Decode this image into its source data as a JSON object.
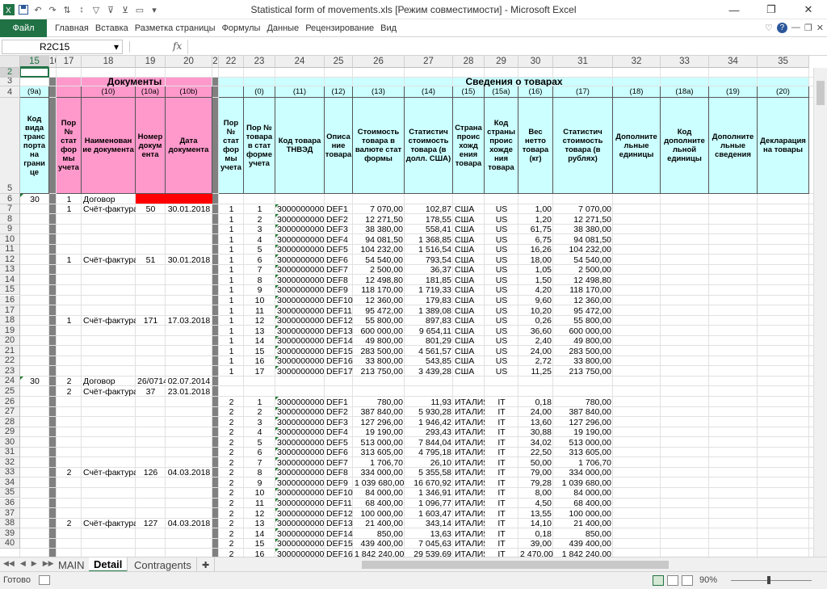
{
  "window": {
    "title": "Statistical form of movements.xls  [Режим совместимости] - Microsoft Excel",
    "min": "—",
    "restore": "❐",
    "close": "✕"
  },
  "ribbon": {
    "file": "Файл",
    "tabs": [
      "Главная",
      "Вставка",
      "Разметка страницы",
      "Формулы",
      "Данные",
      "Рецензирование",
      "Вид"
    ]
  },
  "formula": {
    "namebox": "R2C15",
    "fx": "fx",
    "value": ""
  },
  "columns": [
    {
      "label": "15",
      "sel": true
    },
    {
      "label": "16"
    },
    {
      "label": "17"
    },
    {
      "label": "18"
    },
    {
      "label": "19"
    },
    {
      "label": "20"
    },
    {
      "label": "2"
    },
    {
      "label": "22"
    },
    {
      "label": "23"
    },
    {
      "label": "24"
    },
    {
      "label": "25"
    },
    {
      "label": "26"
    },
    {
      "label": "27"
    },
    {
      "label": "28"
    },
    {
      "label": "29"
    },
    {
      "label": "30"
    },
    {
      "label": "31"
    },
    {
      "label": "32"
    },
    {
      "label": "33"
    },
    {
      "label": "34"
    },
    {
      "label": "35"
    }
  ],
  "row_numbers": [
    "2",
    "3",
    "4",
    "5",
    "6",
    "7",
    "8",
    "9",
    "10",
    "11",
    "12",
    "13",
    "14",
    "15",
    "16",
    "17",
    "18",
    "19",
    "20",
    "21",
    "22",
    "23",
    "24",
    "25",
    "26",
    "27",
    "28",
    "29",
    "30",
    "31",
    "32",
    "33",
    "34",
    "35",
    "36",
    "37",
    "38",
    "39",
    "40"
  ],
  "headers": {
    "section_docs": "Документы",
    "section_goods": "Сведения о товарах",
    "codes": [
      "(9а)",
      "",
      "(10)",
      "(10а)",
      "(10b)",
      "",
      "(0)",
      "(11)",
      "(12)",
      "(13)",
      "(14)",
      "(15)",
      "(15а)",
      "(16)",
      "(17)",
      "(18)",
      "(18а)",
      "(19)",
      "(20)"
    ],
    "names": [
      "Код вида транс порта на грани це",
      "Пор № стат фор мы учета",
      "Наименован ие документа",
      "Номер докум ента",
      "Дата документа",
      "Пор № стат фор мы учета",
      "Пор № товара в стат форме учета",
      "Код товара ТНВЭД",
      "Описа ние товара",
      "Стоимость товара в валюте стат формы",
      "Статистич стоимость товара (в долл. США)",
      "Страна проис хожд ения товара",
      "Код страны проис хожде ния товара",
      "Вес нетто товара (кг)",
      "Статистич стоимость товара (в рублях)",
      "Дополните льные единицы",
      "Код дополните льной единицы",
      "Дополните льные сведения",
      "Декларация на товары"
    ]
  },
  "rows": [
    {
      "r": "6",
      "k": "30",
      "f": "1",
      "n": "Договор",
      "nd": "",
      "d": "",
      "red": true
    },
    {
      "r": "7",
      "f": "1",
      "n": "Счёт-фактура",
      "nd": "50",
      "d": "30.01.2018",
      "sf": "1",
      "p": "1",
      "code": "3000000000",
      "desc": "DEF1",
      "cur": "7 070,00",
      "usd": "102,87",
      "cty": "США",
      "cc": "US",
      "w": "1,00",
      "rub": "7 070,00"
    },
    {
      "r": "8",
      "sf": "1",
      "p": "2",
      "code": "3000000000",
      "desc": "DEF2",
      "cur": "12 271,50",
      "usd": "178,55",
      "cty": "США",
      "cc": "US",
      "w": "1,20",
      "rub": "12 271,50"
    },
    {
      "r": "9",
      "sf": "1",
      "p": "3",
      "code": "3000000000",
      "desc": "DEF3",
      "cur": "38 380,00",
      "usd": "558,41",
      "cty": "США",
      "cc": "US",
      "w": "61,75",
      "rub": "38 380,00"
    },
    {
      "r": "10",
      "sf": "1",
      "p": "4",
      "code": "3000000000",
      "desc": "DEF4",
      "cur": "94 081,50",
      "usd": "1 368,85",
      "cty": "США",
      "cc": "US",
      "w": "6,75",
      "rub": "94 081,50"
    },
    {
      "r": "11",
      "sf": "1",
      "p": "5",
      "code": "3000000000",
      "desc": "DEF5",
      "cur": "104 232,00",
      "usd": "1 516,54",
      "cty": "США",
      "cc": "US",
      "w": "16,26",
      "rub": "104 232,00"
    },
    {
      "r": "12",
      "f": "1",
      "n": "Счёт-фактура",
      "nd": "51",
      "d": "30.01.2018",
      "sf": "1",
      "p": "6",
      "code": "3000000000",
      "desc": "DEF6",
      "cur": "54 540,00",
      "usd": "793,54",
      "cty": "США",
      "cc": "US",
      "w": "18,00",
      "rub": "54 540,00"
    },
    {
      "r": "13",
      "sf": "1",
      "p": "7",
      "code": "3000000000",
      "desc": "DEF7",
      "cur": "2 500,00",
      "usd": "36,37",
      "cty": "США",
      "cc": "US",
      "w": "1,05",
      "rub": "2 500,00"
    },
    {
      "r": "14",
      "sf": "1",
      "p": "8",
      "code": "3000000000",
      "desc": "DEF8",
      "cur": "12 498,80",
      "usd": "181,85",
      "cty": "США",
      "cc": "US",
      "w": "1,50",
      "rub": "12 498,80"
    },
    {
      "r": "15",
      "sf": "1",
      "p": "9",
      "code": "3000000000",
      "desc": "DEF9",
      "cur": "118 170,00",
      "usd": "1 719,33",
      "cty": "США",
      "cc": "US",
      "w": "4,20",
      "rub": "118 170,00"
    },
    {
      "r": "16",
      "sf": "1",
      "p": "10",
      "code": "3000000000",
      "desc": "DEF10",
      "cur": "12 360,00",
      "usd": "179,83",
      "cty": "США",
      "cc": "US",
      "w": "9,60",
      "rub": "12 360,00"
    },
    {
      "r": "17",
      "sf": "1",
      "p": "11",
      "code": "3000000000",
      "desc": "DEF11",
      "cur": "95 472,00",
      "usd": "1 389,08",
      "cty": "США",
      "cc": "US",
      "w": "10,20",
      "rub": "95 472,00"
    },
    {
      "r": "18",
      "f": "1",
      "n": "Счёт-фактура",
      "nd": "171",
      "d": "17.03.2018",
      "sf": "1",
      "p": "12",
      "code": "3000000000",
      "desc": "DEF12",
      "cur": "55 800,00",
      "usd": "897,83",
      "cty": "США",
      "cc": "US",
      "w": "0,26",
      "rub": "55 800,00"
    },
    {
      "r": "19",
      "sf": "1",
      "p": "13",
      "code": "3000000000",
      "desc": "DEF13",
      "cur": "600 000,00",
      "usd": "9 654,11",
      "cty": "США",
      "cc": "US",
      "w": "36,60",
      "rub": "600 000,00"
    },
    {
      "r": "20",
      "sf": "1",
      "p": "14",
      "code": "3000000000",
      "desc": "DEF14",
      "cur": "49 800,00",
      "usd": "801,29",
      "cty": "США",
      "cc": "US",
      "w": "2,40",
      "rub": "49 800,00"
    },
    {
      "r": "21",
      "sf": "1",
      "p": "15",
      "code": "3000000000",
      "desc": "DEF15",
      "cur": "283 500,00",
      "usd": "4 561,57",
      "cty": "США",
      "cc": "US",
      "w": "24,00",
      "rub": "283 500,00"
    },
    {
      "r": "22",
      "sf": "1",
      "p": "16",
      "code": "3000000000",
      "desc": "DEF16",
      "cur": "33 800,00",
      "usd": "543,85",
      "cty": "США",
      "cc": "US",
      "w": "2,72",
      "rub": "33 800,00"
    },
    {
      "r": "23",
      "sf": "1",
      "p": "17",
      "code": "3000000000",
      "desc": "DEF17",
      "cur": "213 750,00",
      "usd": "3 439,28",
      "cty": "США",
      "cc": "US",
      "w": "11,25",
      "rub": "213 750,00"
    },
    {
      "r": "24",
      "k": "30",
      "f": "2",
      "n": "Договор",
      "nd": "26/0714",
      "d": "02.07.2014"
    },
    {
      "r": "25",
      "f": "2",
      "n": "Счёт-фактура",
      "nd": "37",
      "d": "23.01.2018"
    },
    {
      "r": "26",
      "sf": "2",
      "p": "1",
      "code": "3000000000",
      "desc": "DEF1",
      "cur": "780,00",
      "usd": "11,93",
      "cty": "ИТАЛИЯ",
      "cc": "IT",
      "w": "0,18",
      "rub": "780,00"
    },
    {
      "r": "27",
      "sf": "2",
      "p": "2",
      "code": "3000000000",
      "desc": "DEF2",
      "cur": "387 840,00",
      "usd": "5 930,28",
      "cty": "ИТАЛИЯ",
      "cc": "IT",
      "w": "24,00",
      "rub": "387 840,00"
    },
    {
      "r": "28",
      "sf": "2",
      "p": "3",
      "code": "3000000000",
      "desc": "DEF3",
      "cur": "127 296,00",
      "usd": "1 946,42",
      "cty": "ИТАЛИЯ",
      "cc": "IT",
      "w": "13,60",
      "rub": "127 296,00"
    },
    {
      "r": "29",
      "sf": "2",
      "p": "4",
      "code": "3000000000",
      "desc": "DEF4",
      "cur": "19 190,00",
      "usd": "293,43",
      "cty": "ИТАЛИЯ",
      "cc": "IT",
      "w": "30,88",
      "rub": "19 190,00"
    },
    {
      "r": "30",
      "sf": "2",
      "p": "5",
      "code": "3000000000",
      "desc": "DEF5",
      "cur": "513 000,00",
      "usd": "7 844,04",
      "cty": "ИТАЛИЯ",
      "cc": "IT",
      "w": "34,02",
      "rub": "513 000,00"
    },
    {
      "r": "31",
      "sf": "2",
      "p": "6",
      "code": "3000000000",
      "desc": "DEF6",
      "cur": "313 605,00",
      "usd": "4 795,18",
      "cty": "ИТАЛИЯ",
      "cc": "IT",
      "w": "22,50",
      "rub": "313 605,00"
    },
    {
      "r": "32",
      "sf": "2",
      "p": "7",
      "code": "3000000000",
      "desc": "DEF7",
      "cur": "1 706,70",
      "usd": "26,10",
      "cty": "ИТАЛИЯ",
      "cc": "IT",
      "w": "50,00",
      "rub": "1 706,70"
    },
    {
      "r": "33",
      "f": "2",
      "n": "Счёт-фактура",
      "nd": "126",
      "d": "04.03.2018",
      "sf": "2",
      "p": "8",
      "code": "3000000000",
      "desc": "DEF8",
      "cur": "334 000,00",
      "usd": "5 355,58",
      "cty": "ИТАЛИЯ",
      "cc": "IT",
      "w": "79,00",
      "rub": "334 000,00"
    },
    {
      "r": "34",
      "sf": "2",
      "p": "9",
      "code": "3000000000",
      "desc": "DEF9",
      "cur": "1 039 680,00",
      "usd": "16 670,92",
      "cty": "ИТАЛИЯ",
      "cc": "IT",
      "w": "79,28",
      "rub": "1 039 680,00"
    },
    {
      "r": "35",
      "sf": "2",
      "p": "10",
      "code": "3000000000",
      "desc": "DEF10",
      "cur": "84 000,00",
      "usd": "1 346,91",
      "cty": "ИТАЛИЯ",
      "cc": "IT",
      "w": "8,00",
      "rub": "84 000,00"
    },
    {
      "r": "36",
      "sf": "2",
      "p": "11",
      "code": "3000000000",
      "desc": "DEF11",
      "cur": "68 400,00",
      "usd": "1 096,77",
      "cty": "ИТАЛИЯ",
      "cc": "IT",
      "w": "4,50",
      "rub": "68 400,00"
    },
    {
      "r": "37",
      "sf": "2",
      "p": "12",
      "code": "3000000000",
      "desc": "DEF12",
      "cur": "100 000,00",
      "usd": "1 603,47",
      "cty": "ИТАЛИЯ",
      "cc": "IT",
      "w": "13,55",
      "rub": "100 000,00"
    },
    {
      "r": "38",
      "f": "2",
      "n": "Счёт-фактура",
      "nd": "127",
      "d": "04.03.2018",
      "sf": "2",
      "p": "13",
      "code": "3000000000",
      "desc": "DEF13",
      "cur": "21 400,00",
      "usd": "343,14",
      "cty": "ИТАЛИЯ",
      "cc": "IT",
      "w": "14,10",
      "rub": "21 400,00"
    },
    {
      "r": "39",
      "sf": "2",
      "p": "14",
      "code": "3000000000",
      "desc": "DEF14",
      "cur": "850,00",
      "usd": "13,63",
      "cty": "ИТАЛИЯ",
      "cc": "IT",
      "w": "0,18",
      "rub": "850,00"
    },
    {
      "r": "40",
      "sf": "2",
      "p": "15",
      "code": "3000000000",
      "desc": "DEF15",
      "cur": "439 400,00",
      "usd": "7 045,63",
      "cty": "ИТАЛИЯ",
      "cc": "IT",
      "w": "39,00",
      "rub": "439 400,00"
    },
    {
      "r": "41",
      "sf": "2",
      "p": "16",
      "code": "3000000000",
      "desc": "DEF16",
      "cur": "1 842 240,00",
      "usd": "29 539,69",
      "cty": "ИТАЛИЯ",
      "cc": "IT",
      "w": "2 470,00",
      "rub": "1 842 240,00"
    }
  ],
  "sheets": {
    "tabs": [
      "MAIN",
      "Detail",
      "Contragents"
    ],
    "active": "Detail"
  },
  "status": {
    "text": "Готово",
    "zoom": "90%"
  },
  "colors": {
    "docs_fill": "#ff99cc",
    "goods_fill": "#ccffff",
    "sep_fill": "#808080",
    "red_fill": "#ff0000",
    "accent": "#217346"
  }
}
